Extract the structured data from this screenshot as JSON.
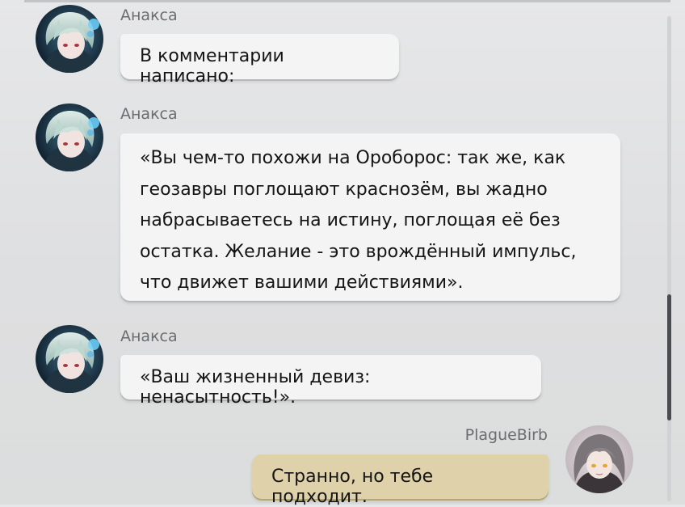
{
  "messages": [
    {
      "sender": "Анакса",
      "text": "В комментарии написано:"
    },
    {
      "sender": "Анакса",
      "lines": [
        "«Вы чем-то похожи на Оробо­рос: так же, как",
        "геозавры поглощают краснозём, вы жадно",
        "набрасываетесь на истину, поглощая её без",
        "остатка. Желание - это врождённый импульс,",
        "что движет вашими действиями»."
      ]
    },
    {
      "sender": "Анакса",
      "text": "«Ваш жизненный девиз: ненасытность!»."
    },
    {
      "sender": "PlagueBirb",
      "text": "Странно, но тебе подходит."
    }
  ],
  "colors": {
    "left_bubble": "#f4f4f4",
    "right_bubble": "#dfd1a9",
    "name_text": "#6b6d70",
    "scrollbar_thumb": "#4a4c50"
  },
  "icons": [
    "anaxa-avatar",
    "plaguebirb-avatar"
  ]
}
